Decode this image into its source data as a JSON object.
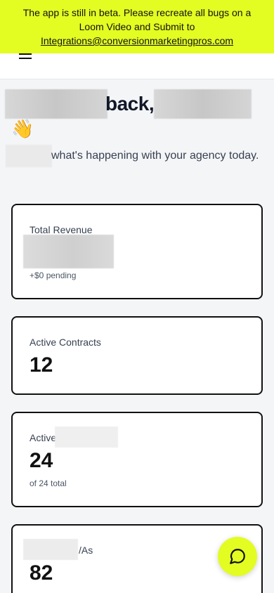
{
  "banner": {
    "line1": "The app is still in beta. Please recreate all bugs on a",
    "line2": "Loom Video and Submit to",
    "email": "Integrations@conversionmarketingpros.com"
  },
  "greeting": {
    "title_visible": "back,",
    "wave_emoji": "👋",
    "subtitle_visible": "what's happening with your agency today."
  },
  "cards": [
    {
      "label": "Total Revenue",
      "value": "",
      "sub": "+$0 pending"
    },
    {
      "label": "Active Contracts",
      "value": "12",
      "sub": ""
    },
    {
      "label": "Active",
      "value": "24",
      "sub": "of 24 total"
    },
    {
      "label": "/As",
      "value": "82",
      "sub": ""
    }
  ],
  "icons": {
    "menu": "hamburger-icon",
    "chat": "chat-bubble-icon"
  },
  "colors": {
    "accent": "#e3fc22",
    "background": "#f4f5f7",
    "card_border": "#111111"
  }
}
